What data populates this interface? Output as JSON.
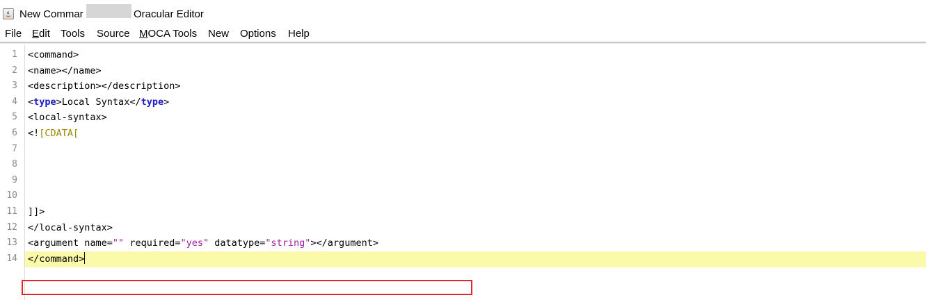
{
  "window": {
    "title_left": "New Commar",
    "title_right": "Oracular Editor"
  },
  "menu": {
    "items": [
      "File",
      "Edit",
      "Tools",
      "Source",
      "MOCA Tools",
      "New",
      "Options",
      "Help"
    ]
  },
  "editor": {
    "line_numbers": [
      "1",
      "2",
      "3",
      "4",
      "5",
      "6",
      "7",
      "8",
      "9",
      "10",
      "11",
      "12",
      "13",
      "14"
    ],
    "current_line": 14,
    "lines": [
      [
        {
          "t": "tag",
          "v": "<command>"
        }
      ],
      [
        {
          "t": "tag",
          "v": "<name></name>"
        }
      ],
      [
        {
          "t": "tag",
          "v": "<description></description>"
        }
      ],
      [
        {
          "t": "tag",
          "v": "<"
        },
        {
          "t": "kw",
          "v": "type"
        },
        {
          "t": "tag",
          "v": ">Local Syntax</"
        },
        {
          "t": "kw",
          "v": "type"
        },
        {
          "t": "tag",
          "v": ">"
        }
      ],
      [
        {
          "t": "tag",
          "v": "<local-syntax>"
        }
      ],
      [
        {
          "t": "tag",
          "v": "<!"
        },
        {
          "t": "cdata",
          "v": "[CDATA["
        }
      ],
      [],
      [],
      [],
      [],
      [
        {
          "t": "tag",
          "v": "]]>"
        }
      ],
      [
        {
          "t": "tag",
          "v": "</local-syntax>"
        }
      ],
      [
        {
          "t": "tag",
          "v": "<argument name="
        },
        {
          "t": "str",
          "v": "\"\""
        },
        {
          "t": "tag",
          "v": " required="
        },
        {
          "t": "str",
          "v": "\"yes\""
        },
        {
          "t": "tag",
          "v": " datatype="
        },
        {
          "t": "str",
          "v": "\"string\""
        },
        {
          "t": "tag",
          "v": "></argument>"
        }
      ],
      [
        {
          "t": "tag",
          "v": "</command>"
        }
      ]
    ]
  },
  "colors": {
    "keyword": "#1a1ac8",
    "cdata": "#9b8a00",
    "string": "#a020a0",
    "current_line_bg": "#fafaaa",
    "highlight_box": "#e0262b"
  }
}
